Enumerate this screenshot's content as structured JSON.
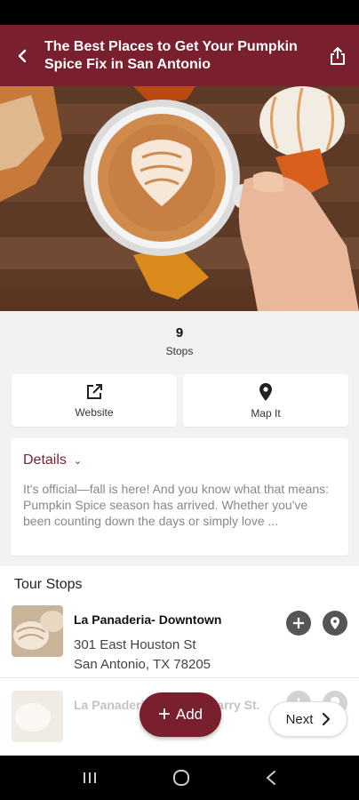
{
  "header": {
    "title": "The Best Places to Get Your Pumpkin Spice Fix in San Antonio",
    "back_icon": "back-arrow-icon",
    "share_icon": "share-icon"
  },
  "hero": {
    "image": "pumpkin-spice-latte-photo"
  },
  "stats": {
    "count": "9",
    "label": "Stops"
  },
  "actions": {
    "website_label": "Website",
    "website_icon": "external-link-icon",
    "map_label": "Map It",
    "map_icon": "map-pin-icon"
  },
  "details": {
    "heading": "Details",
    "text": "It's official—fall is here! And you know what that means: Pumpkin Spice season has arrived. Whether you've been counting down the days or simply love ..."
  },
  "tour": {
    "title": "Tour Stops",
    "stops": [
      {
        "name": "La Panaderia- Downtown",
        "address_line1": "301 East Houston St",
        "address_line2": "San Antonio, TX 78205"
      },
      {
        "name": "La Panaderia- Alamo Quarry St."
      }
    ]
  },
  "fab": {
    "add_label": "Add"
  },
  "next": {
    "label": "Next"
  },
  "colors": {
    "brand": "#7a1f2e",
    "icon_grey": "#555555"
  }
}
